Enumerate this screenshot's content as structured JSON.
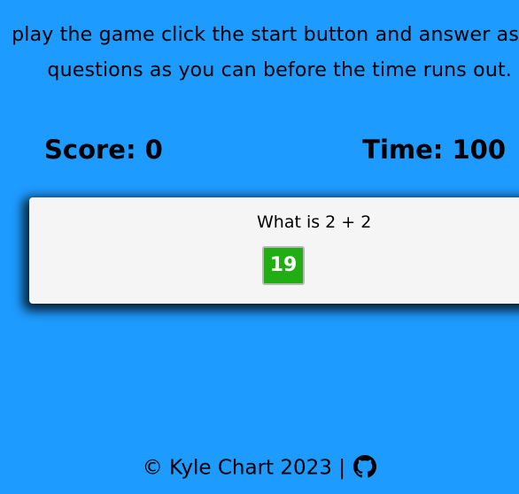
{
  "instructions": {
    "line1": "play the game click the start button and answer as",
    "line2": "questions as you can before the time runs out."
  },
  "scoreboard": {
    "score_label": "Score: 0",
    "time_label": "Time: 100"
  },
  "quiz": {
    "question": "What is 2 + 2",
    "answers": [
      "19"
    ],
    "answer_color": "#22ad14"
  },
  "footer": {
    "text": "© Kyle Chart 2023 |",
    "icon": "github-icon"
  },
  "colors": {
    "background": "#1e9bff",
    "card": "#f5f5f5"
  }
}
